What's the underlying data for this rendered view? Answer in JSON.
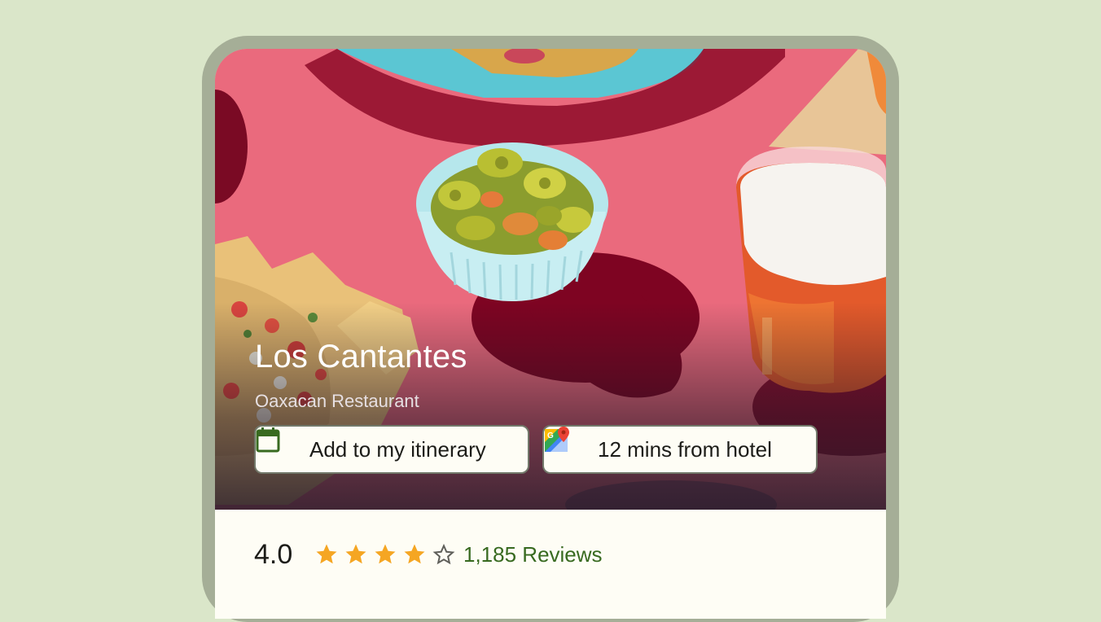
{
  "restaurant": {
    "name": "Los Cantantes",
    "cuisine": "Oaxacan Restaurant"
  },
  "actions": {
    "itinerary_label": "Add to my itinerary",
    "distance_label": "12 mins from hotel"
  },
  "rating": {
    "score": "4.0",
    "stars_filled": 4,
    "stars_total": 5,
    "reviews_label": "1,185 Reviews"
  },
  "colors": {
    "background": "#dae6c9",
    "device_frame": "#a5ae97",
    "surface": "#fefdf5",
    "accent_green": "#386a20",
    "star": "#f5a623"
  },
  "icons": {
    "itinerary": "calendar-icon",
    "distance": "google-maps-icon",
    "star_filled": "star-filled-icon",
    "star_empty": "star-outline-icon"
  }
}
